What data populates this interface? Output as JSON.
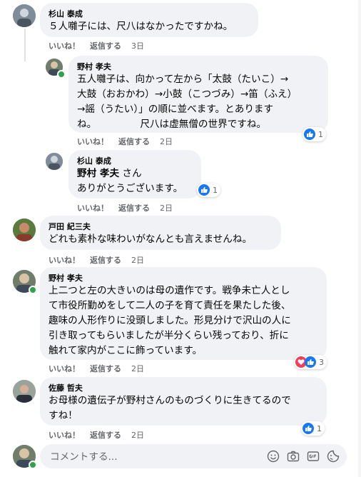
{
  "comments": [
    {
      "author": "杉山 泰成",
      "text": "５人囃子には、尺八はなかったですかね。",
      "like_label": "いいね！",
      "reply_label": "返信する",
      "time": "3日"
    },
    {
      "author": "野村 孝夫",
      "text": "五人囃子は、向かって左から「太鼓（たいこ）→\n大鼓（おおかわ）→小鼓（こつづみ）→笛（ふえ）\n→謡（うたい）」の順に並べます。とあります\nね。　　　　　尺八は虚無僧の世界ですね。",
      "like_label": "いいね！",
      "reply_label": "返信する",
      "time": "2日",
      "reaction_count": "1"
    },
    {
      "author": "杉山 泰成",
      "mention": "野村 孝夫",
      "mention_suffix": " さん",
      "text": "ありがとうございます。",
      "like_label": "いいね！",
      "reply_label": "返信する",
      "time": "2日",
      "reaction_count": "1"
    },
    {
      "author": "戸田 紀三夫",
      "text": "どれも素朴な味わいがなんとも言えませんね。",
      "like_label": "いいね！",
      "reply_label": "返信する",
      "time": "2日"
    },
    {
      "author": "野村 孝夫",
      "text": "上二つと左の大きいのは母の遺作です。戦争未亡人とし\nて市役所勤めをして二人の子を育て責任を果たした後、\n趣味の人形作りに没頭しました。形見分けで沢山の人に\n引き取ってもらいましたが半分くらい残っており、折に\n触れて家内がここに飾っています。",
      "like_label": "いいね！",
      "reply_label": "返信する",
      "time": "2日",
      "reaction_count": "3"
    },
    {
      "author": "佐藤 哲夫",
      "text": "お母様の遺伝子が野村さんのものづくりに生きてるので\nすね！",
      "like_label": "いいね！",
      "reply_label": "返信する",
      "time": "2日",
      "reaction_count": "1"
    }
  ],
  "composer": {
    "placeholder": "コメントする..."
  },
  "icons": {
    "like": "thumbs-up-icon",
    "love": "heart-icon",
    "emoji": "smiley-icon",
    "camera": "camera-icon",
    "gif": "gif-icon",
    "sticker": "sticker-icon"
  },
  "colors": {
    "like_blue": "#1877f2",
    "love_red": "#f33e58",
    "bubble_bg": "#f0f2f5",
    "meta_gray": "#65676b",
    "online_green": "#31a24c"
  }
}
